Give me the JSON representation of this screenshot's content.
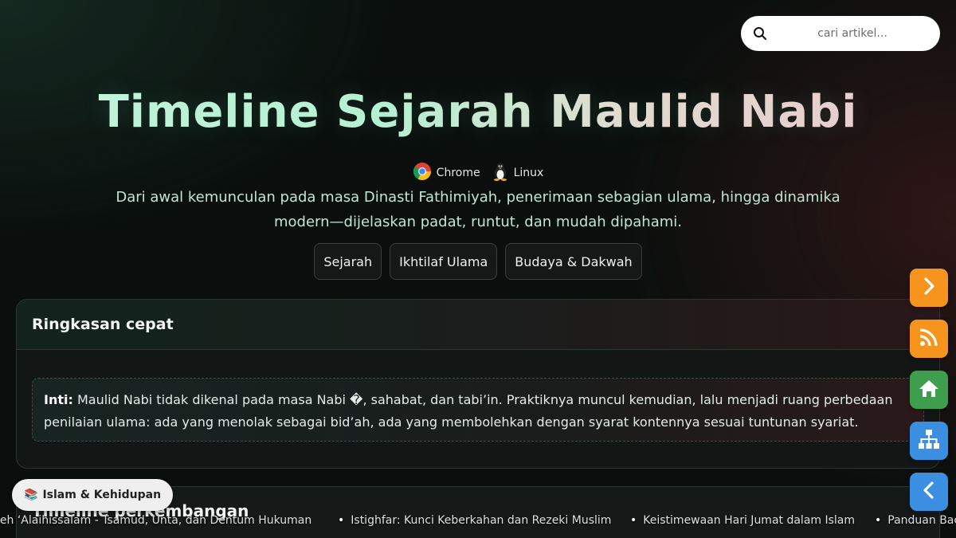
{
  "search": {
    "placeholder": "cari artikel..."
  },
  "hero": {
    "title": "Timeline Sejarah Maulid Nabi",
    "platforms": [
      {
        "name": "Chrome",
        "icon": "chrome-icon"
      },
      {
        "name": "Linux",
        "icon": "linux-tux-icon"
      }
    ],
    "subtitle": "Dari awal kemunculan pada masa Dinasti Fathimiyah, penerimaan sebagian ulama, hingga dinamika modern—dijelaskan padat, runtut, dan mudah dipahami.",
    "tags": [
      "Sejarah",
      "Ikhtilaf Ulama",
      "Budaya & Dakwah"
    ]
  },
  "summary": {
    "heading": "Ringkasan cepat",
    "note_label": "Inti:",
    "note_text": " Maulid Nabi tidak dikenal pada masa Nabi �, sahabat, dan tabi’in. Praktiknya muncul kemudian, lalu menjadi ruang perbedaan penilaian ulama: ada yang menolak sebagai bid’ah, ada yang membolehkan dengan syarat kontennya sesuai tuntunan syariat."
  },
  "timeline": {
    "heading": "Timeline perkembangan"
  },
  "category_chip": {
    "emoji": "📚",
    "label": "Islam & Kehidupan"
  },
  "ticker": [
    "leh ‘Alaihissalam - Tsamud, Unta, dan Dentum Hukuman",
    "Istighfar: Kunci Keberkahan dan Rezeki Muslim",
    "Keistimewaan Hari Jumat dalam Islam",
    "Panduan Bac"
  ],
  "side_buttons": [
    {
      "icon": "chevron-right-icon",
      "color": "#f7941d"
    },
    {
      "icon": "rss-icon",
      "color": "#f7941d"
    },
    {
      "icon": "home-icon",
      "color": "#3f9e4d"
    },
    {
      "icon": "sitemap-icon",
      "color": "#3b8fe0"
    },
    {
      "icon": "chevron-left-icon",
      "color": "#3b8fe0"
    }
  ]
}
